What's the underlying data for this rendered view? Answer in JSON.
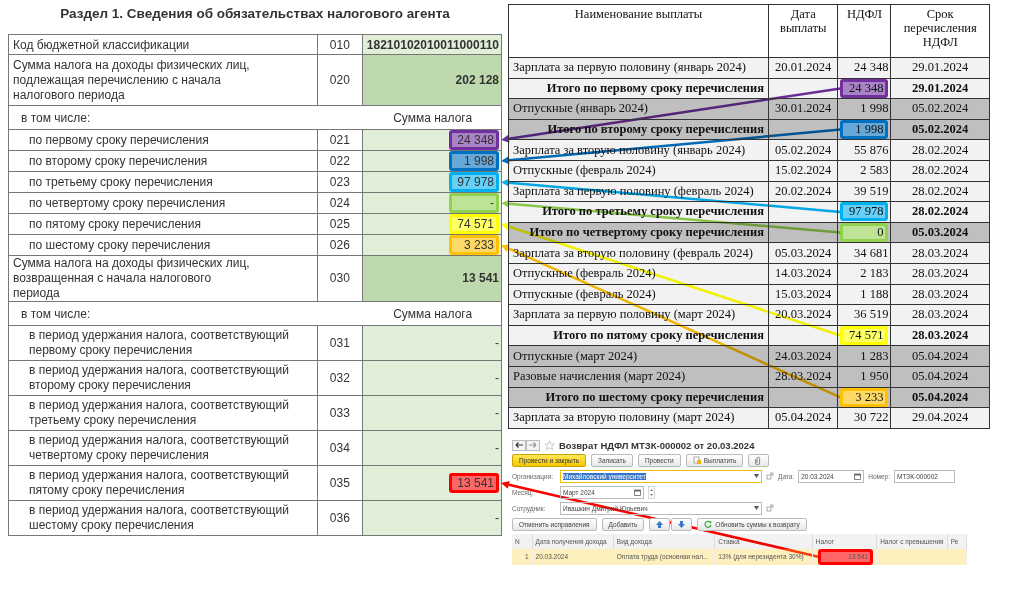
{
  "report": {
    "title": "Раздел 1. Сведения об обязательствах налогового агента",
    "rows": [
      {
        "kind": "code",
        "label": "Код бюджетной классификации",
        "code": "010",
        "value": "18210102010011000110"
      },
      {
        "kind": "total",
        "label": "Сумма налога на доходы физических лиц, подлежащая перечислению с начала налогового периода",
        "code": "020",
        "value": "202 128"
      },
      {
        "kind": "subheader",
        "label": "в том числе:",
        "value": "Сумма налога"
      },
      {
        "kind": "line",
        "label": "по первому сроку перечисления",
        "code": "021",
        "value": "24 348",
        "color": "#7030a0"
      },
      {
        "kind": "line",
        "label": "по второму сроку перечисления",
        "code": "022",
        "value": "1 998",
        "color": "#0070c0"
      },
      {
        "kind": "line",
        "label": "по третьему сроку перечисления",
        "code": "023",
        "value": "97 978",
        "color": "#00b0f0"
      },
      {
        "kind": "line",
        "label": "по четвертому сроку перечисления",
        "code": "024",
        "value": "-",
        "color": "#92d050"
      },
      {
        "kind": "line",
        "label": "по пятому сроку перечисления",
        "code": "025",
        "value": "74 571",
        "color": "#ffff00"
      },
      {
        "kind": "line",
        "label": "по шестому сроку перечисления",
        "code": "026",
        "value": "3 233",
        "color": "#ffc000"
      },
      {
        "kind": "total",
        "label": "Сумма налога на доходы физических лиц, возвращенная с начала налогового периода",
        "code": "030",
        "value": "13 541"
      },
      {
        "kind": "subheader",
        "label": "в том числе:",
        "value": "Сумма налога"
      },
      {
        "kind": "tall",
        "label": "в период удержания налога, соответствующий первому сроку перечисления",
        "code": "031",
        "value": "-"
      },
      {
        "kind": "tall",
        "label": "в период удержания налога, соответствующий второму сроку перечисления",
        "code": "032",
        "value": "-"
      },
      {
        "kind": "tall",
        "label": "в период удержания налога, соответствующий третьему сроку перечисления",
        "code": "033",
        "value": "-"
      },
      {
        "kind": "tall",
        "label": "в период удержания налога, соответствующий четвертому сроку перечисления",
        "code": "034",
        "value": "-"
      },
      {
        "kind": "tall",
        "label": "в период удержания налога, соответствующий пятому сроку перечисления",
        "code": "035",
        "value": "13 541",
        "color": "#ff0000"
      },
      {
        "kind": "tall",
        "label": "в период удержания налога, соответствующий шестому сроку перечисления",
        "code": "036",
        "value": "-"
      }
    ]
  },
  "payments": {
    "columns": [
      "Наименование выплаты",
      "Дата выплаты",
      "НДФЛ",
      "Срок перечисления НДФЛ"
    ],
    "rows": [
      {
        "kind": "item",
        "shaded": false,
        "name": "Зарплата за первую половину (январь 2024)",
        "date": "20.01.2024",
        "ndfl": "24 348",
        "term": "29.01.2024"
      },
      {
        "kind": "total",
        "shaded": false,
        "name": "Итого по первому сроку перечисления",
        "ndfl": "24 348",
        "term": "29.01.2024",
        "color": "#7030a0"
      },
      {
        "kind": "item",
        "shaded": true,
        "name": "Отпускные (январь 2024)",
        "date": "30.01.2024",
        "ndfl": "1 998",
        "term": "05.02.2024"
      },
      {
        "kind": "total",
        "shaded": true,
        "name": "Итого по второму сроку перечисления",
        "ndfl": "1 998",
        "term": "05.02.2024",
        "color": "#0070c0"
      },
      {
        "kind": "item",
        "shaded": false,
        "name": "Зарплата за вторую половину (январь 2024)",
        "date": "05.02.2024",
        "ndfl": "55 876",
        "term": "28.02.2024"
      },
      {
        "kind": "item",
        "shaded": false,
        "name": "Отпускные (февраль 2024)",
        "date": "15.02.2024",
        "ndfl": "2 583",
        "term": "28.02.2024"
      },
      {
        "kind": "item",
        "shaded": false,
        "name": "Зарплата за первую половину (февраль 2024)",
        "date": "20.02.2024",
        "ndfl": "39 519",
        "term": "28.02.2024"
      },
      {
        "kind": "total",
        "shaded": false,
        "name": "Итого по третьему сроку перечисления",
        "ndfl": "97 978",
        "term": "28.02.2024",
        "color": "#00b0f0"
      },
      {
        "kind": "total",
        "shaded": true,
        "name": "Итого по четвертому сроку перечисления",
        "ndfl": "0",
        "term": "05.03.2024",
        "color": "#92d050"
      },
      {
        "kind": "item",
        "shaded": false,
        "name": "Зарплата за вторую половину (февраль 2024)",
        "date": "05.03.2024",
        "ndfl": "34 681",
        "term": "28.03.2024"
      },
      {
        "kind": "item",
        "shaded": false,
        "name": "Отпускные (февраль 2024)",
        "date": "14.03.2024",
        "ndfl": "2 183",
        "term": "28.03.2024"
      },
      {
        "kind": "item",
        "shaded": false,
        "name": "Отпускные (февраль 2024)",
        "date": "15.03.2024",
        "ndfl": "1 188",
        "term": "28.03.2024"
      },
      {
        "kind": "item",
        "shaded": false,
        "name": "Зарплата за первую половину (март 2024)",
        "date": "20.03.2024",
        "ndfl": "36 519",
        "term": "28.03.2024"
      },
      {
        "kind": "total",
        "shaded": false,
        "name": "Итого по пятому сроку перечисления",
        "ndfl": "74 571",
        "term": "28.03.2024",
        "color": "#ffff00"
      },
      {
        "kind": "item",
        "shaded": true,
        "name": "Отпускные (март 2024)",
        "date": "24.03.2024",
        "ndfl": "1 283",
        "term": "05.04.2024"
      },
      {
        "kind": "item",
        "shaded": true,
        "name": "Разовые начисления (март 2024)",
        "date": "28.03.2024",
        "ndfl": "1 950",
        "term": "05.04.2024"
      },
      {
        "kind": "total",
        "shaded": true,
        "name": "Итого по шестому сроку перечисления",
        "ndfl": "3 233",
        "term": "05.04.2024",
        "color": "#ffc000"
      },
      {
        "kind": "item",
        "shaded": false,
        "name": "Зарплата за вторую половину (март 2024)",
        "date": "05.04.2024",
        "ndfl": "30 722",
        "term": "29.04.2024"
      }
    ]
  },
  "document": {
    "title": "Возврат НДФЛ МТЗК-000002 от 20.03.2024",
    "toolbar": [
      {
        "kind": "primary",
        "label": "Провести и закрыть"
      },
      {
        "kind": "plain",
        "label": "Записать"
      },
      {
        "kind": "plain",
        "label": "Провести"
      },
      {
        "kind": "pay",
        "label": "Выплатить"
      },
      {
        "kind": "attach"
      }
    ],
    "field_rows": [
      [
        {
          "kind": "dropdown",
          "label": "Организация:",
          "value": "Михайловский  университет",
          "focused": true,
          "selected": true
        },
        {
          "kind": "date",
          "label": "Дата:",
          "value": "20.03.2024",
          "focused": false,
          "selected": false
        },
        {
          "kind": "text",
          "label": "Номер:",
          "value": "МТЗК-000002",
          "focused": false,
          "selected": false
        }
      ],
      [
        {
          "kind": "month",
          "label": "Месяц:",
          "value": "Март 2024",
          "focused": false,
          "selected": false
        }
      ],
      [
        {
          "kind": "dropdown",
          "label": "Сотрудник:",
          "value": "Ивашкин Дмитрий Юрьевич",
          "focused": false,
          "selected": false
        }
      ]
    ],
    "grid_toolbar": [
      {
        "kind": "plain",
        "label": "Отменить исправления"
      },
      {
        "kind": "plain",
        "label": "Добавить"
      },
      {
        "kind": "move"
      },
      {
        "kind": "refresh",
        "label": "Обновить суммы к возврату"
      }
    ],
    "grid": {
      "columns": [
        "N",
        "Дата получения дохода",
        "Вид дохода",
        "Ставка",
        "Налог",
        "Налог с превышения",
        "Ре"
      ],
      "rows": [
        {
          "n": "1",
          "date": "20.03.2024",
          "income": "Оплата труда (основная нал...",
          "rate": "13% (для нерезидента 30%)",
          "tax": "13 541",
          "selected": true,
          "color": "#ff0000"
        }
      ]
    }
  }
}
